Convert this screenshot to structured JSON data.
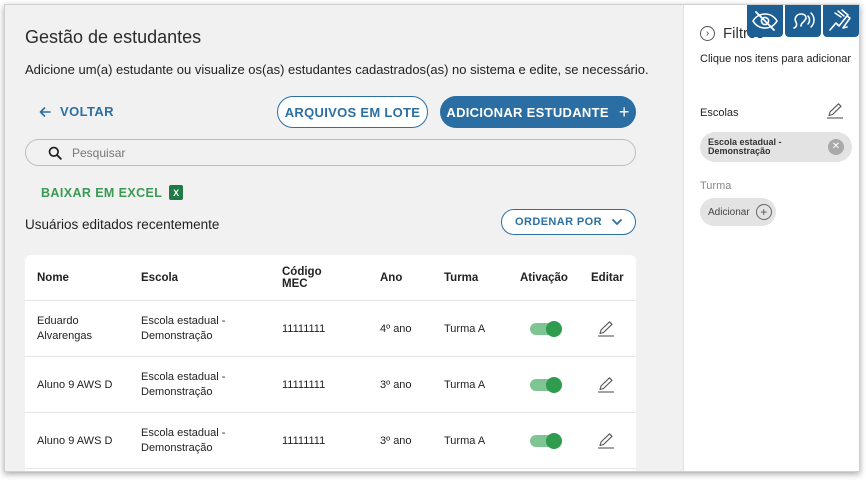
{
  "page": {
    "title": "Gestão de estudantes",
    "subtitle": "Adicione um(a) estudante ou visualize os(as) estudantes cadastrados(as) no sistema e edite, se necessário."
  },
  "actions": {
    "back_label": "VOLTAR",
    "batch_label": "ARQUIVOS EM LOTE",
    "add_label": "ADICIONAR ESTUDANTE"
  },
  "search": {
    "placeholder": "Pesquisar",
    "value": ""
  },
  "excel": {
    "label": "BAIXAR EM EXCEL",
    "icon_text": "X"
  },
  "recent": {
    "title": "Usuários editados recentemente",
    "order_label": "ORDENAR POR"
  },
  "table": {
    "headers": [
      "Nome",
      "Escola",
      "Código MEC",
      "Ano",
      "Turma",
      "Ativação",
      "Editar"
    ],
    "rows": [
      {
        "nome": "Eduardo Alvarengas",
        "escola": "Escola estadual - Demonstração",
        "codigo": "11111111",
        "ano": "4º ano",
        "turma": "Turma A",
        "ativo": true
      },
      {
        "nome": "Aluno 9 AWS D",
        "escola": "Escola estadual - Demonstração",
        "codigo": "11111111",
        "ano": "3º ano",
        "turma": "Turma A",
        "ativo": true
      },
      {
        "nome": "Aluno 9 AWS D",
        "escola": "Escola estadual - Demonstração",
        "codigo": "11111111",
        "ano": "3º ano",
        "turma": "Turma A",
        "ativo": true
      }
    ]
  },
  "filters": {
    "title": "Filtros",
    "hint": "Clique nos itens para adicionar",
    "escolas_label": "Escolas",
    "escola_chip": "Escola estadual - Demonstração",
    "turma_label": "Turma",
    "add_label": "Adicionar"
  },
  "colors": {
    "primary": "#2a6ea3",
    "excel": "#3a9a52",
    "toggle_on": "#2f9b4e",
    "a11y": "#1d5f93"
  },
  "icons": [
    "arrow-left-icon",
    "plus-icon",
    "search-icon",
    "excel-icon",
    "chevron-down-icon",
    "pencil-icon",
    "chevron-right-circle-icon",
    "close-icon",
    "eye-slash-icon",
    "audio-icon",
    "sign-language-icon"
  ]
}
